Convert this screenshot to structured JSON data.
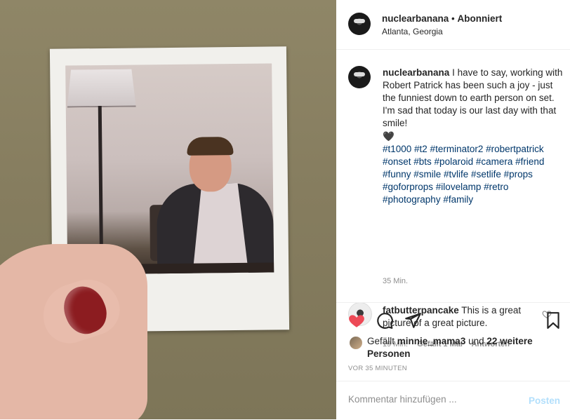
{
  "header": {
    "username": "nuclearbanana",
    "separator": " • ",
    "follow_status": "Abonniert",
    "location": "Atlanta, Georgia"
  },
  "caption": {
    "username": "nuclearbanana",
    "text": "I have to say, working with Robert Patrick has been such a joy - just the funniest down to earth person on set. I'm sad that today is our last day with that smile!",
    "emoji": "🖤",
    "hashtags": "#t1000 #t2 #terminator2 #robertpatrick #onset #bts #polaroid #camera #friend #funny #smile #tvlife #setlife #props #goforprops #ilovelamp #retro #photography #family",
    "time": "35 Min."
  },
  "comment": {
    "username": "fatbutterpancake",
    "text": "This is a great picture of a great picture.",
    "time": "19 Min.",
    "likes": "Gefällt 1 Mal",
    "reply": "Antworten"
  },
  "likes": {
    "prefix": "Gefällt ",
    "user": "minnie_mama3",
    "middle": " und ",
    "others": "22 weitere Personen"
  },
  "post_time": "VOR 35 MINUTEN",
  "comment_box": {
    "placeholder": "Kommentar hinzufügen ...",
    "post_label": "Posten"
  },
  "colors": {
    "like_red": "#ed4956",
    "hashtag_blue": "#00376b",
    "post_disabled": "#b2dffc"
  }
}
